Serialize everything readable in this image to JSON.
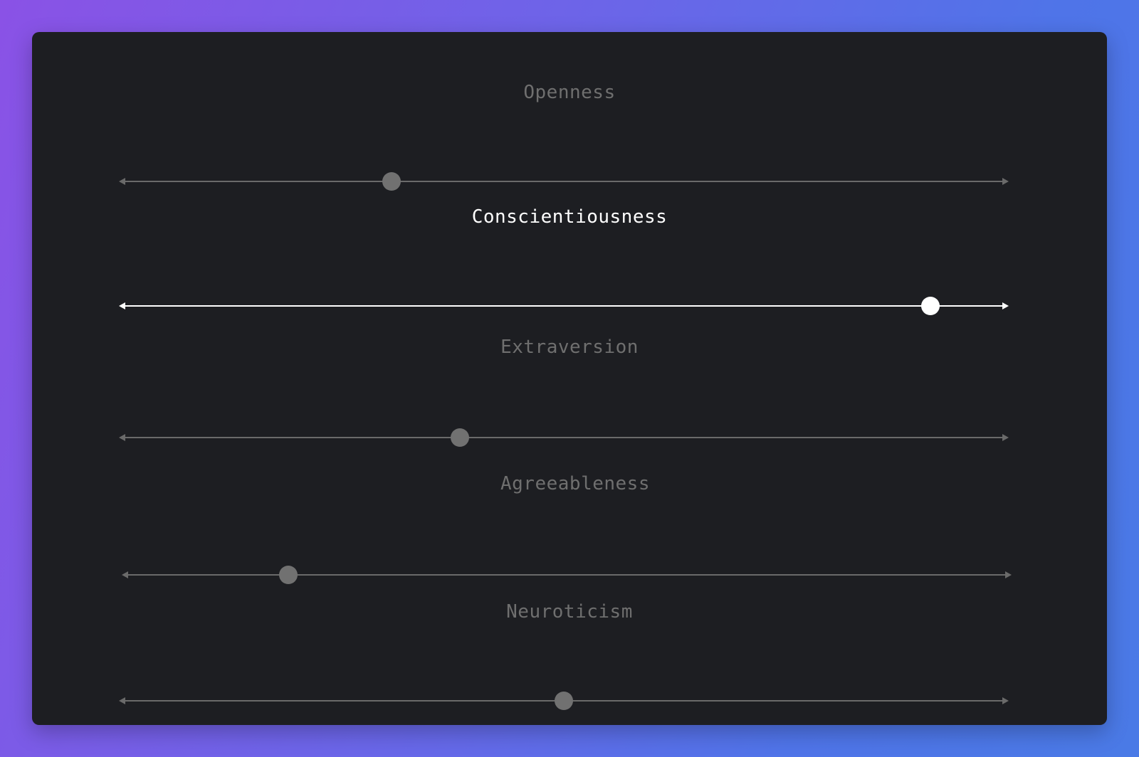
{
  "traits": [
    {
      "label": "Openness",
      "value": 0.306,
      "active": false
    },
    {
      "label": "Conscientiousness",
      "value": 0.912,
      "active": true
    },
    {
      "label": "Extraversion",
      "value": 0.383,
      "active": false
    },
    {
      "label": "Agreeableness",
      "value": 0.187,
      "active": false
    },
    {
      "label": "Neuroticism",
      "value": 0.5,
      "active": false
    }
  ],
  "colors": {
    "background_start": "#8a52e6",
    "background_end": "#4a7ae6",
    "panel": "#1d1e22",
    "inactive": "#6f6f6f",
    "active": "#ffffff"
  }
}
